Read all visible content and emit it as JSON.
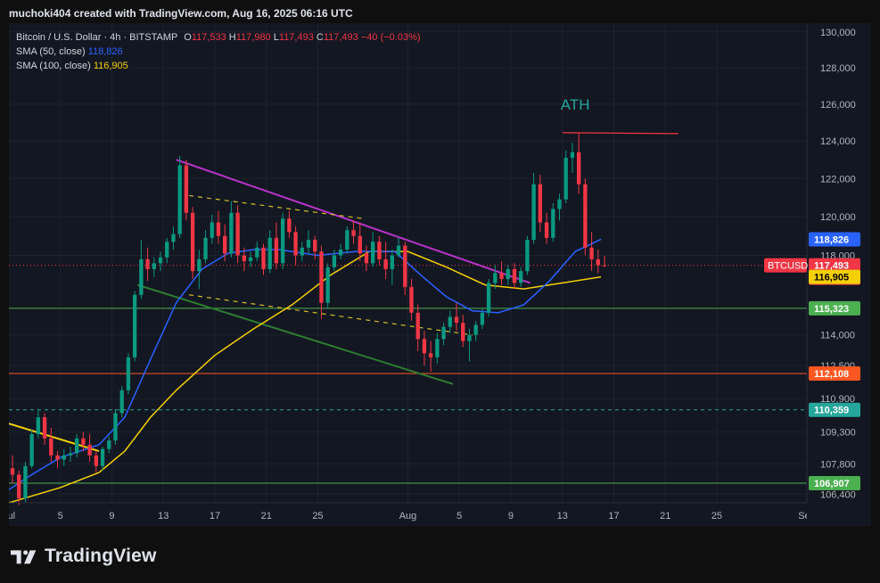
{
  "byline": "muchoki404 created with TradingView.com, Aug 16, 2025 06:16 UTC",
  "legend": {
    "symbol": "Bitcoin / U.S. Dollar · 4h · BITSTAMP",
    "o_label": "O",
    "o": "117,533",
    "h_label": "H",
    "h": "117,980",
    "l_label": "L",
    "l": "117,493",
    "c_label": "C",
    "c": "117,493",
    "change": "−40 (−0.03%)",
    "sma50_label": "SMA (50, close)",
    "sma50_value": "118,826",
    "sma100_label": "SMA (100, close)",
    "sma100_value": "116,905"
  },
  "brand": "TradingView",
  "colors": {
    "background": "#131722",
    "grid": "#1e222d",
    "candle_up": "#089981",
    "candle_down": "#f23645",
    "sma50": "#2962ff",
    "sma100": "#f5d000",
    "trend_purple": "#b634c8",
    "trend_green": "#2e7d32",
    "support_green": "#4caf50",
    "support_orange": "#ff5722",
    "support_teal": "#26a69a"
  },
  "chart_data": {
    "type": "candlestick",
    "symbol": "BTCUSD",
    "timeframe": "4h",
    "x_axis_labels": [
      {
        "label": "Jul",
        "date": "2025-07-01"
      },
      {
        "label": "5",
        "date": "2025-07-05"
      },
      {
        "label": "9",
        "date": "2025-07-09"
      },
      {
        "label": "13",
        "date": "2025-07-13"
      },
      {
        "label": "17",
        "date": "2025-07-17"
      },
      {
        "label": "21",
        "date": "2025-07-21"
      },
      {
        "label": "25",
        "date": "2025-07-25"
      },
      {
        "label": "Aug",
        "date": "2025-08-01"
      },
      {
        "label": "5",
        "date": "2025-08-05"
      },
      {
        "label": "9",
        "date": "2025-08-09"
      },
      {
        "label": "13",
        "date": "2025-08-13"
      },
      {
        "label": "17",
        "date": "2025-08-17"
      },
      {
        "label": "21",
        "date": "2025-08-21"
      },
      {
        "label": "25",
        "date": "2025-08-25"
      },
      {
        "label": "Sep",
        "date": "2025-09-01"
      }
    ],
    "x_range": [
      "2025-07-01",
      "2025-09-01"
    ],
    "y_tick_labels": [
      "130,000",
      "128,000",
      "126,000",
      "124,000",
      "122,000",
      "120,000",
      "118,000",
      "114,000",
      "112,500",
      "110,900",
      "109,300",
      "107,800",
      "106,400"
    ],
    "y_ticks": [
      130000,
      128000,
      126000,
      124000,
      122000,
      120000,
      118000,
      114000,
      112500,
      110900,
      109300,
      107800,
      106400
    ],
    "ylim": [
      106000,
      130500
    ],
    "scale": "log",
    "candles": [
      [
        "2025-07-01T00:00",
        107600,
        108200,
        106900,
        107300
      ],
      [
        "2025-07-01T12:00",
        107300,
        107500,
        105900,
        106200
      ],
      [
        "2025-07-02T00:00",
        106200,
        107900,
        106000,
        107700
      ],
      [
        "2025-07-02T12:00",
        107700,
        109400,
        107600,
        109200
      ],
      [
        "2025-07-03T00:00",
        109200,
        110400,
        109000,
        110000
      ],
      [
        "2025-07-03T12:00",
        110000,
        110200,
        108700,
        109000
      ],
      [
        "2025-07-04T00:00",
        109000,
        109500,
        107900,
        108200
      ],
      [
        "2025-07-04T12:00",
        108200,
        108400,
        107600,
        108000
      ],
      [
        "2025-07-05T00:00",
        108000,
        108500,
        107700,
        108200
      ],
      [
        "2025-07-05T12:00",
        108200,
        108600,
        107900,
        108300
      ],
      [
        "2025-07-06T00:00",
        108300,
        109200,
        108100,
        109000
      ],
      [
        "2025-07-06T12:00",
        109000,
        109300,
        108400,
        108700
      ],
      [
        "2025-07-07T00:00",
        108700,
        109200,
        107900,
        108200
      ],
      [
        "2025-07-07T12:00",
        108200,
        108400,
        107400,
        107700
      ],
      [
        "2025-07-08T00:00",
        107700,
        108600,
        107500,
        108500
      ],
      [
        "2025-07-08T12:00",
        108500,
        109100,
        108300,
        108900
      ],
      [
        "2025-07-09T00:00",
        108900,
        110400,
        108700,
        110200
      ],
      [
        "2025-07-09T12:00",
        110200,
        111500,
        110000,
        111300
      ],
      [
        "2025-07-10T00:00",
        111300,
        113100,
        111100,
        112900
      ],
      [
        "2025-07-10T12:00",
        112900,
        116200,
        112700,
        116000
      ],
      [
        "2025-07-11T00:00",
        116000,
        118800,
        115800,
        117800
      ],
      [
        "2025-07-11T12:00",
        117800,
        118400,
        116700,
        117300
      ],
      [
        "2025-07-12T00:00",
        117300,
        117900,
        116900,
        117600
      ],
      [
        "2025-07-12T12:00",
        117600,
        118200,
        117200,
        117900
      ],
      [
        "2025-07-13T00:00",
        117900,
        118900,
        117600,
        118700
      ],
      [
        "2025-07-13T12:00",
        118700,
        119500,
        118300,
        119100
      ],
      [
        "2025-07-14T00:00",
        119100,
        123200,
        118900,
        122700
      ],
      [
        "2025-07-14T12:00",
        122700,
        123000,
        119800,
        120200
      ],
      [
        "2025-07-15T00:00",
        120200,
        120500,
        116800,
        117200
      ],
      [
        "2025-07-15T12:00",
        117200,
        118300,
        116300,
        117800
      ],
      [
        "2025-07-16T00:00",
        117800,
        119300,
        117600,
        118900
      ],
      [
        "2025-07-16T12:00",
        118900,
        120100,
        118600,
        119700
      ],
      [
        "2025-07-17T00:00",
        119700,
        120300,
        118600,
        119000
      ],
      [
        "2025-07-17T12:00",
        119000,
        119600,
        117700,
        118100
      ],
      [
        "2025-07-18T00:00",
        118100,
        120800,
        117900,
        120200
      ],
      [
        "2025-07-18T12:00",
        120200,
        120600,
        117600,
        118000
      ],
      [
        "2025-07-19T00:00",
        118000,
        118400,
        117200,
        117700
      ],
      [
        "2025-07-19T12:00",
        117700,
        118200,
        117400,
        117900
      ],
      [
        "2025-07-20T00:00",
        117900,
        118700,
        117700,
        118400
      ],
      [
        "2025-07-20T12:00",
        118400,
        118600,
        117000,
        117300
      ],
      [
        "2025-07-21T00:00",
        117300,
        119300,
        117100,
        118900
      ],
      [
        "2025-07-21T12:00",
        118900,
        119700,
        117300,
        117600
      ],
      [
        "2025-07-22T00:00",
        117600,
        120200,
        117300,
        119900
      ],
      [
        "2025-07-22T12:00",
        119900,
        120300,
        118900,
        119200
      ],
      [
        "2025-07-23T00:00",
        119200,
        119500,
        117500,
        118000
      ],
      [
        "2025-07-23T12:00",
        118000,
        118700,
        117700,
        118400
      ],
      [
        "2025-07-24T00:00",
        118400,
        119300,
        118100,
        118800
      ],
      [
        "2025-07-24T12:00",
        118800,
        119000,
        117800,
        118200
      ],
      [
        "2025-07-25T00:00",
        118200,
        118500,
        114800,
        115600
      ],
      [
        "2025-07-25T12:00",
        115600,
        117600,
        115300,
        117400
      ],
      [
        "2025-07-26T00:00",
        117400,
        118300,
        117200,
        118000
      ],
      [
        "2025-07-26T12:00",
        118000,
        118600,
        117800,
        118300
      ],
      [
        "2025-07-27T00:00",
        118300,
        119500,
        118100,
        119300
      ],
      [
        "2025-07-27T12:00",
        119300,
        119800,
        118600,
        119000
      ],
      [
        "2025-07-28T00:00",
        119000,
        119700,
        117700,
        118100
      ],
      [
        "2025-07-28T12:00",
        118100,
        118500,
        117200,
        117600
      ],
      [
        "2025-07-29T00:00",
        117600,
        119200,
        117400,
        118700
      ],
      [
        "2025-07-29T12:00",
        118700,
        119000,
        117500,
        117800
      ],
      [
        "2025-07-30T00:00",
        117800,
        118700,
        116800,
        117300
      ],
      [
        "2025-07-30T12:00",
        117300,
        118300,
        116500,
        118000
      ],
      [
        "2025-07-31T00:00",
        118000,
        118900,
        117900,
        118500
      ],
      [
        "2025-07-31T12:00",
        118500,
        118700,
        116000,
        116400
      ],
      [
        "2025-08-01T00:00",
        116400,
        116800,
        114700,
        115100
      ],
      [
        "2025-08-01T12:00",
        115100,
        115500,
        113200,
        113800
      ],
      [
        "2025-08-02T00:00",
        113800,
        114200,
        112500,
        113100
      ],
      [
        "2025-08-02T12:00",
        113100,
        113700,
        112200,
        112900
      ],
      [
        "2025-08-03T00:00",
        112900,
        114100,
        112600,
        113800
      ],
      [
        "2025-08-03T12:00",
        113800,
        114600,
        113500,
        114400
      ],
      [
        "2025-08-04T00:00",
        114400,
        115200,
        114100,
        114900
      ],
      [
        "2025-08-04T12:00",
        114900,
        115600,
        114200,
        114600
      ],
      [
        "2025-08-05T00:00",
        114600,
        115000,
        113400,
        113700
      ],
      [
        "2025-08-05T12:00",
        113700,
        114300,
        112700,
        114000
      ],
      [
        "2025-08-06T00:00",
        114000,
        114700,
        113700,
        114500
      ],
      [
        "2025-08-06T12:00",
        114500,
        115300,
        114300,
        115100
      ],
      [
        "2025-08-07T00:00",
        115100,
        116800,
        114900,
        116600
      ],
      [
        "2025-08-07T12:00",
        116600,
        117500,
        116300,
        117100
      ],
      [
        "2025-08-08T00:00",
        117100,
        117700,
        116500,
        116800
      ],
      [
        "2025-08-08T12:00",
        116800,
        117500,
        116500,
        117300
      ],
      [
        "2025-08-09T00:00",
        117300,
        117600,
        116300,
        116600
      ],
      [
        "2025-08-09T12:00",
        116600,
        117400,
        116400,
        117200
      ],
      [
        "2025-08-10T00:00",
        117200,
        119000,
        117000,
        118800
      ],
      [
        "2025-08-10T12:00",
        118800,
        122300,
        118600,
        121700
      ],
      [
        "2025-08-11T00:00",
        121700,
        122200,
        119200,
        119700
      ],
      [
        "2025-08-11T12:00",
        119700,
        120200,
        118600,
        118900
      ],
      [
        "2025-08-12T00:00",
        118900,
        120700,
        118700,
        120400
      ],
      [
        "2025-08-12T12:00",
        120400,
        121200,
        119800,
        120900
      ],
      [
        "2025-08-13T00:00",
        120900,
        123500,
        120700,
        123100
      ],
      [
        "2025-08-13T12:00",
        123100,
        123900,
        122300,
        123400
      ],
      [
        "2025-08-14T00:00",
        123400,
        124450,
        121200,
        121700
      ],
      [
        "2025-08-14T12:00",
        121700,
        122000,
        118000,
        118400
      ],
      [
        "2025-08-15T00:00",
        118400,
        119200,
        117200,
        117800
      ],
      [
        "2025-08-15T12:00",
        117800,
        118300,
        117100,
        117500
      ],
      [
        "2025-08-16T00:00",
        117500,
        117980,
        117400,
        117493
      ]
    ],
    "sma50": [
      [
        "2025-07-01T00:00",
        106600
      ],
      [
        "2025-07-02T12:00",
        107200
      ],
      [
        "2025-07-05T00:00",
        108100
      ],
      [
        "2025-07-08T00:00",
        108700
      ],
      [
        "2025-07-10T00:00",
        110000
      ],
      [
        "2025-07-12T00:00",
        112800
      ],
      [
        "2025-07-14T00:00",
        115600
      ],
      [
        "2025-07-16T00:00",
        117300
      ],
      [
        "2025-07-18T00:00",
        118100
      ],
      [
        "2025-07-20T00:00",
        118300
      ],
      [
        "2025-07-22T00:00",
        118300
      ],
      [
        "2025-07-25T00:00",
        118000
      ],
      [
        "2025-07-28T00:00",
        118200
      ],
      [
        "2025-07-31T00:00",
        118200
      ],
      [
        "2025-08-02T00:00",
        117000
      ],
      [
        "2025-08-04T00:00",
        115900
      ],
      [
        "2025-08-06T00:00",
        115200
      ],
      [
        "2025-08-08T00:00",
        115100
      ],
      [
        "2025-08-10T00:00",
        115500
      ],
      [
        "2025-08-12T00:00",
        116700
      ],
      [
        "2025-08-14T00:00",
        118200
      ],
      [
        "2025-08-16T00:00",
        118826
      ]
    ],
    "sma100": [
      [
        "2025-07-01T00:00",
        106000
      ],
      [
        "2025-07-05T00:00",
        106700
      ],
      [
        "2025-07-08T00:00",
        107400
      ],
      [
        "2025-07-10T00:00",
        108400
      ],
      [
        "2025-07-12T00:00",
        110000
      ],
      [
        "2025-07-14T00:00",
        111300
      ],
      [
        "2025-07-17T00:00",
        113000
      ],
      [
        "2025-07-20T00:00",
        114300
      ],
      [
        "2025-07-23T00:00",
        115500
      ],
      [
        "2025-07-26T00:00",
        117000
      ],
      [
        "2025-07-29T00:00",
        118200
      ],
      [
        "2025-08-01T00:00",
        118200
      ],
      [
        "2025-08-04T00:00",
        117400
      ],
      [
        "2025-08-07T00:00",
        116500
      ],
      [
        "2025-08-10T00:00",
        116300
      ],
      [
        "2025-08-13T00:00",
        116600
      ],
      [
        "2025-08-16T00:00",
        116905
      ]
    ],
    "horizontal_levels": [
      {
        "label": "115,323",
        "value": 115323,
        "color": "#4caf50",
        "style": "solid"
      },
      {
        "label": "112,108",
        "value": 112108,
        "color": "#ff5722",
        "style": "solid"
      },
      {
        "label": "110,359",
        "value": 110359,
        "color": "#26a69a",
        "style": "dashed"
      },
      {
        "label": "106,907",
        "value": 106907,
        "color": "#4caf50",
        "style": "solid"
      }
    ],
    "price_labels": [
      {
        "label": "118,826",
        "value": 118826,
        "color": "#2962ff",
        "text_color": "#ffffff"
      },
      {
        "label": "117,493",
        "value": 117493,
        "color": "#f23645",
        "text_color": "#ffffff",
        "timer": "01:43:38",
        "tag": "BTCUSD"
      },
      {
        "label": "116,905",
        "value": 116905,
        "color": "#f5d000",
        "text_color": "#000000"
      }
    ],
    "current_price": 117493,
    "trendlines": [
      {
        "name": "descending-resistance",
        "color": "#b634c8",
        "style": "solid",
        "from": [
          "2025-07-14T00:00",
          123000
        ],
        "to": [
          "2025-08-10T12:00",
          116600
        ]
      },
      {
        "name": "descending-support",
        "color": "#2e7d32",
        "style": "solid",
        "from": [
          "2025-07-11T00:00",
          116500
        ],
        "to": [
          "2025-08-04T12:00",
          111600
        ]
      },
      {
        "name": "channel-upper",
        "color": "#d4c02a",
        "style": "dashed",
        "from": [
          "2025-07-15T00:00",
          121100
        ],
        "to": [
          "2025-07-28T12:00",
          119900
        ]
      },
      {
        "name": "channel-lower",
        "color": "#d4c02a",
        "style": "dashed",
        "from": [
          "2025-07-15T00:00",
          116000
        ],
        "to": [
          "2025-08-06T00:00",
          114000
        ]
      },
      {
        "name": "early-resistance",
        "color": "#f5d000",
        "style": "solid",
        "from": [
          "2025-07-01T00:00",
          109700
        ],
        "to": [
          "2025-07-08T00:00",
          108400
        ]
      },
      {
        "name": "ath-line",
        "color": "#f23645",
        "style": "solid",
        "from": [
          "2025-08-13T00:00",
          124450
        ],
        "to": [
          "2025-08-22T00:00",
          124400
        ]
      }
    ],
    "annotations": [
      {
        "text": "ATH",
        "date": "2025-08-14T00:00",
        "value": 125700,
        "color": "#26a69a"
      }
    ]
  }
}
